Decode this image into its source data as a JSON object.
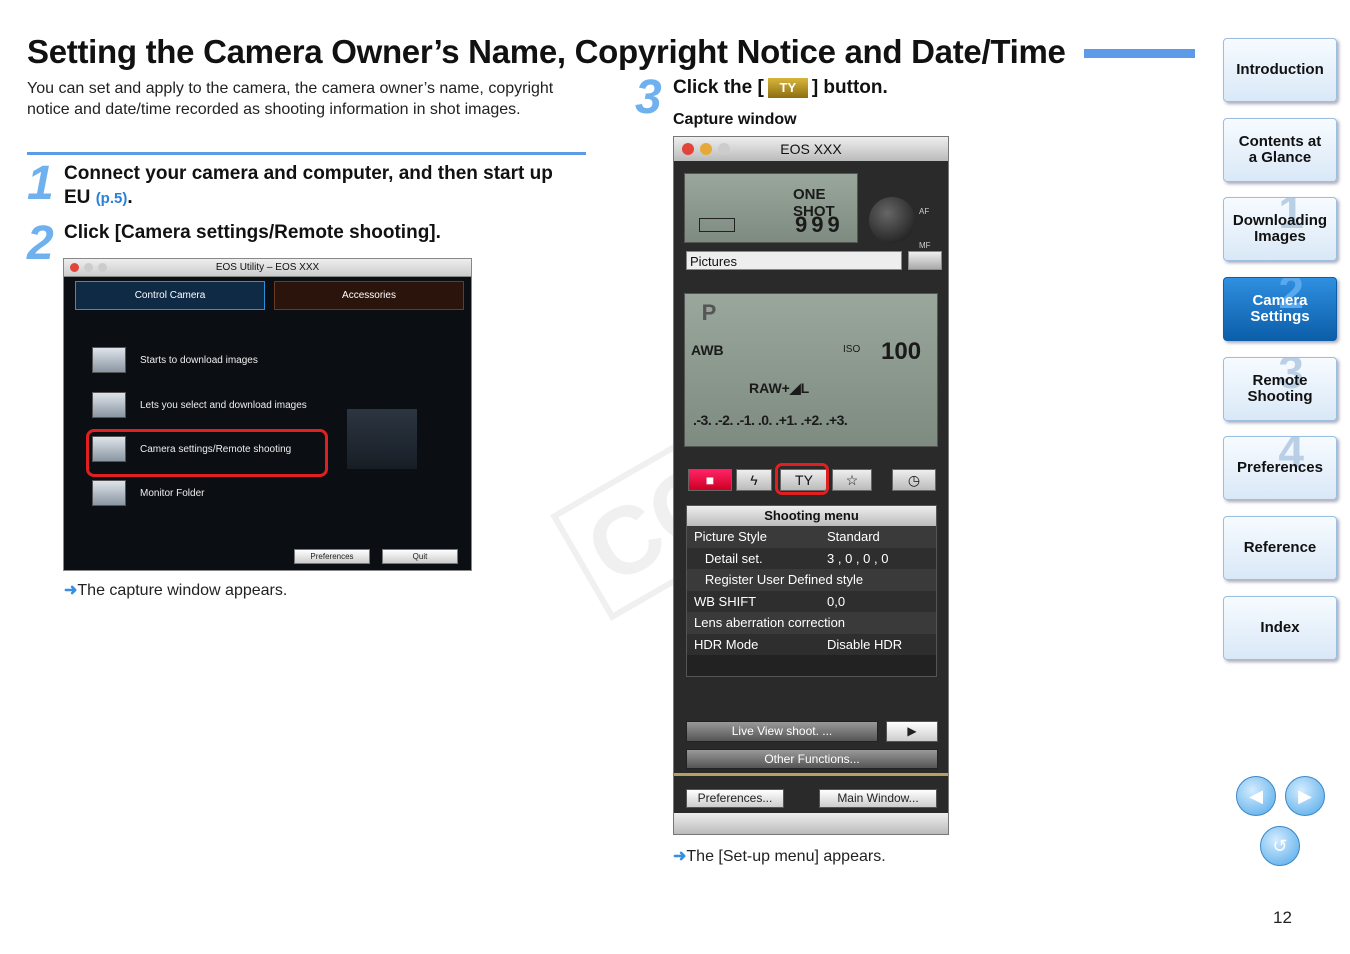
{
  "page": {
    "title": "Setting the Camera Owner’s Name, Copyright Notice and Date/Time",
    "intro": "You can set and apply to the camera, the camera owner’s name, copyright notice and date/time recorded as shooting information in shot images.",
    "page_number": "12",
    "watermark": "COPY"
  },
  "steps": [
    {
      "num": "1",
      "text": "Connect your camera and computer, and then start up EU",
      "link": "(p.5)",
      "end": "."
    },
    {
      "num": "2",
      "text": "Click [Camera settings/Remote shooting].",
      "result": "The capture window appears."
    },
    {
      "num": "3",
      "text_before": "Click the [",
      "text_after": "] button.",
      "caption": "Capture window",
      "result": "The [Set-up menu] appears."
    }
  ],
  "eos_utility": {
    "title": "EOS Utility – EOS XXX",
    "tabs": [
      "Control Camera",
      "Accessories"
    ],
    "items": [
      "Starts to download images",
      "Lets you select and download images",
      "Camera settings/Remote shooting",
      "Monitor Folder"
    ],
    "buttons": [
      "Preferences",
      "Quit"
    ]
  },
  "capture_window": {
    "title": "EOS XXX",
    "lcd_mode": "ONE SHOT",
    "shots": "999",
    "af": "AF",
    "mf": "MF",
    "folder": "Pictures",
    "mode": "P",
    "wb": "AWB",
    "iso_label": "ISO",
    "iso": "100",
    "quality": "RAW+◢L",
    "exposure_scale": ".-3. .-2. .-1. .0. .+1. .+2. .+3.",
    "menu_title": "Shooting menu",
    "menu": [
      {
        "label": "Picture Style",
        "value": "Standard"
      },
      {
        "label": "   Detail set.",
        "value": "3 , 0 , 0 , 0"
      },
      {
        "label": "   Register User Defined style",
        "value": ""
      },
      {
        "label": "WB SHIFT",
        "value": "0,0"
      },
      {
        "label": "Lens aberration correction",
        "value": ""
      },
      {
        "label": "HDR Mode",
        "value": "Disable HDR"
      }
    ],
    "live_view": "Live View shoot. ...",
    "other_functions": "Other Functions...",
    "preferences": "Preferences...",
    "main_window": "Main Window..."
  },
  "sidebar": [
    {
      "label": "Introduction",
      "num": ""
    },
    {
      "label": "Contents at a Glance",
      "num": ""
    },
    {
      "label": "Downloading Images",
      "num": "1"
    },
    {
      "label": "Camera Settings",
      "num": "2"
    },
    {
      "label": "Remote Shooting",
      "num": "3"
    },
    {
      "label": "Preferences",
      "num": "4"
    },
    {
      "label": "Reference",
      "num": ""
    },
    {
      "label": "Index",
      "num": ""
    }
  ],
  "colors": {
    "accent": "#5b9be8",
    "link": "#2a80d8",
    "highlight": "#e02020",
    "active_nav": "#1a73c8"
  }
}
